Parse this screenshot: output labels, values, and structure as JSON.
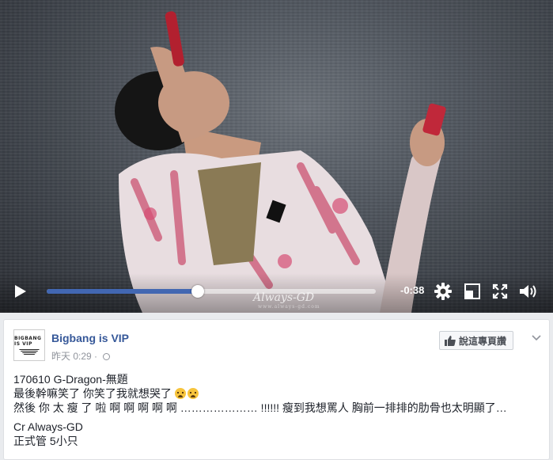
{
  "video": {
    "time_remaining": "-0:38",
    "progress": 0.46,
    "watermark": "Always-GD",
    "watermark_sub": "www.always-gd.com"
  },
  "post": {
    "page_name": "Bigbang is VIP",
    "avatar_text": "BIGBANG IS VIP",
    "time": "昨天 0:29",
    "like_page_label": "說這專頁讚",
    "lines": [
      "170610 G-Dragon-無題",
      "最後幹嘛笑了 你笑了我就想哭了",
      "然後 你 太 瘦 了 啦 啊 啊 啊 啊 啊 ………………… !!!!!! 瘦到我想罵人 胸前一排排的肋骨也太明顯了…"
    ],
    "credit_lines": [
      "Cr Always-GD",
      "正式管 5小只"
    ]
  },
  "colors": {
    "accent": "#4267b2",
    "link": "#365899",
    "meta": "#90949c"
  }
}
